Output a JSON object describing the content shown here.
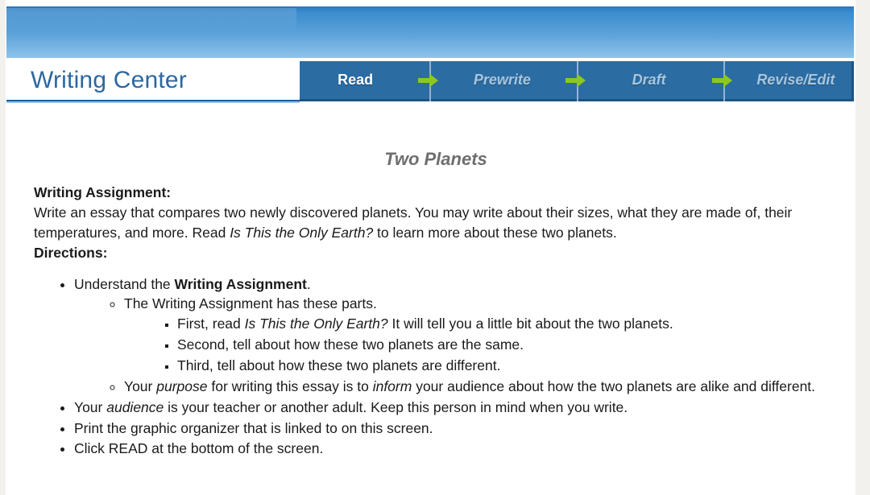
{
  "page": {
    "background_color": "#f2f1ee",
    "banner_color_top": "#2f7fc4",
    "banner_color_bottom": "#8ec4ea"
  },
  "header": {
    "logo_text": "Writing Center",
    "logo_color": "#2d679f",
    "nav_background": "#2b6ca3",
    "arrow_color": "#8dc820",
    "steps": [
      {
        "label": "Read",
        "state": "active"
      },
      {
        "label": "Prewrite",
        "state": "inactive"
      },
      {
        "label": "Draft",
        "state": "inactive"
      },
      {
        "label": "Revise/Edit",
        "state": "inactive"
      }
    ],
    "arrow_icon_name": "arrow-right-icon"
  },
  "document": {
    "title": "Two Planets",
    "title_color": "#6e6e6e",
    "assignment_label": "Writing Assignment:",
    "assignment_text_1": "Write an essay that compares two newly discovered planets. You may write about their sizes, what they are made of, their temperatures, and more. Read ",
    "assignment_book_title": "Is This the Only Earth?",
    "assignment_text_2": " to learn more about these two planets.",
    "directions_label": "Directions:",
    "directions": {
      "item1_pre": "Understand the ",
      "item1_bold": "Writing Assignment",
      "item1_post": ".",
      "sub1": "The Writing Assignment has these parts.",
      "sub1_items": [
        {
          "pre": "First, read ",
          "italic": "Is This the Only Earth?",
          "post": " It will tell you a little bit about the two planets."
        },
        {
          "pre": "Second, tell about how these two planets are the same.",
          "italic": "",
          "post": ""
        },
        {
          "pre": "Third, tell about how these two planets are different.",
          "italic": "",
          "post": ""
        }
      ],
      "sub2_a": "Your ",
      "sub2_ital1": "purpose",
      "sub2_b": " for writing this essay is to ",
      "sub2_ital2": "inform",
      "sub2_c": " your audience about how the two planets are alike and different.",
      "item2_a": "Your ",
      "item2_ital": "audience",
      "item2_b": " is your teacher or another adult. Keep this person in mind when you write.",
      "item3": "Print the graphic organizer that is linked to on this screen.",
      "item4": "Click READ at the bottom of the screen."
    }
  }
}
